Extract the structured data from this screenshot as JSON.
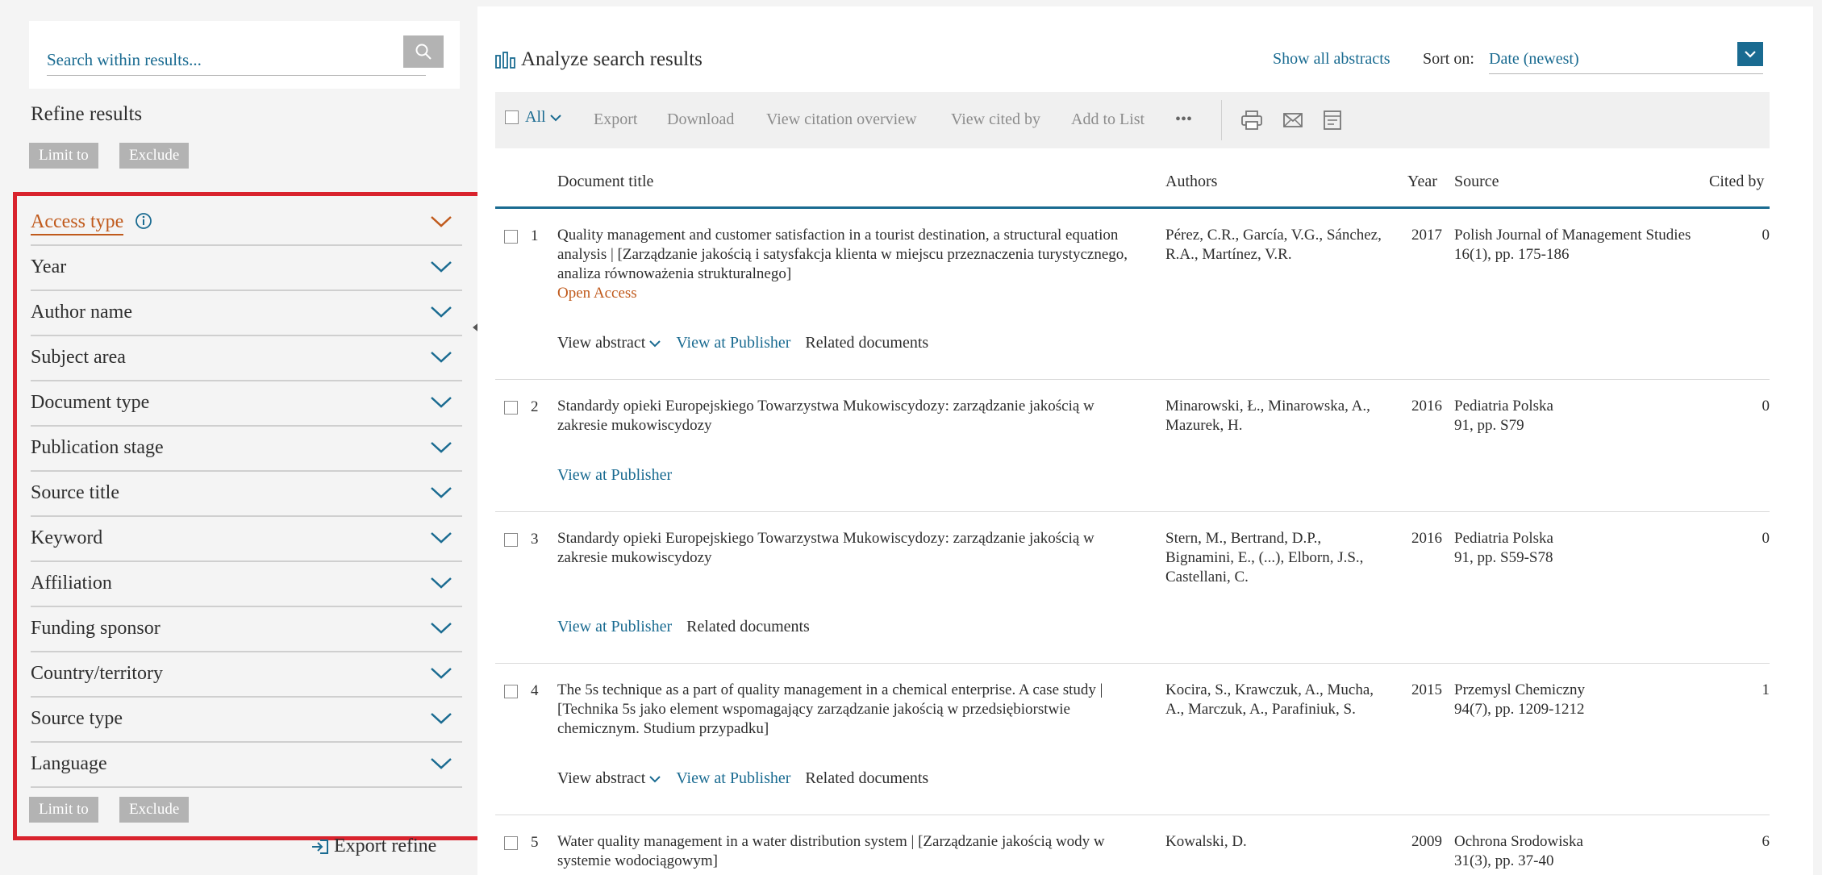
{
  "search": {
    "placeholder": "Search within results..."
  },
  "refine": {
    "title": "Refine results",
    "limit_to": "Limit to",
    "exclude": "Exclude",
    "export_refine": "Export refine",
    "facets": [
      "Access type",
      "Year",
      "Author name",
      "Subject area",
      "Document type",
      "Publication stage",
      "Source title",
      "Keyword",
      "Affiliation",
      "Funding sponsor",
      "Country/territory",
      "Source type",
      "Language"
    ]
  },
  "header": {
    "analyze": "Analyze search results",
    "show_all_abstracts": "Show all abstracts",
    "sort_label": "Sort on:",
    "sort_value": "Date (newest)"
  },
  "toolbar": {
    "all": "All",
    "export": "Export",
    "download": "Download",
    "view_citation_overview": "View citation overview",
    "view_cited_by": "View cited by",
    "add_to_list": "Add to List",
    "more": "•••"
  },
  "columns": {
    "title": "Document title",
    "authors": "Authors",
    "year": "Year",
    "source": "Source",
    "cited_by": "Cited by"
  },
  "results": [
    {
      "num": "1",
      "title": "Quality management and customer satisfaction in a tourist destination, a structural equation analysis | [Zarządzanie jakością i satysfakcja klienta w miejscu przeznaczenia turystycznego, analiza równoważenia strukturalnego]",
      "open_access": "Open Access",
      "authors": "Pérez, C.R., García, V.G., Sánchez, R.A., Martínez, V.R.",
      "year": "2017",
      "source": "Polish Journal of Management Studies",
      "source_detail": "16(1), pp. 175-186",
      "cited": "0",
      "view_abstract": "View abstract",
      "view_at_publisher": "View at Publisher",
      "related": "Related documents"
    },
    {
      "num": "2",
      "title": "Standardy opieki Europejskiego Towarzystwa Mukowiscydozy: zarządzanie jakością w zakresie mukowiscydozy",
      "authors": "Minarowski, Ł., Minarowska, A., Mazurek, H.",
      "year": "2016",
      "source": "Pediatria Polska",
      "source_detail": "91, pp. S79",
      "cited": "0",
      "view_at_publisher": "View at Publisher"
    },
    {
      "num": "3",
      "title": "Standardy opieki Europejskiego Towarzystwa Mukowiscydozy: zarządzanie jakością w zakresie mukowiscydozy",
      "authors": "Stern, M., Bertrand, D.P., Bignamini, E., (...), Elborn, J.S., Castellani, C.",
      "year": "2016",
      "source": "Pediatria Polska",
      "source_detail": "91, pp. S59-S78",
      "cited": "0",
      "view_at_publisher": "View at Publisher",
      "related": "Related documents"
    },
    {
      "num": "4",
      "title": "The 5s technique as a part of quality management in a chemical enterprise. A case study | [Technika 5s jako element wspomagający zarządzanie jakością w przedsiębiorstwie chemicznym. Studium przypadku]",
      "authors": "Kocira, S., Krawczuk, A., Mucha, A., Marczuk, A., Parafiniuk, S.",
      "year": "2015",
      "source": "Przemysl Chemiczny",
      "source_detail": "94(7), pp. 1209-1212",
      "cited": "1",
      "view_abstract": "View abstract",
      "view_at_publisher": "View at Publisher",
      "related": "Related documents"
    },
    {
      "num": "5",
      "title": "Water quality management in a water distribution system | [Zarządzanie jakością wody w systemie wodociągowym]",
      "authors": "Kowalski, D.",
      "year": "2009",
      "source": "Ochrona Srodowiska",
      "source_detail": "31(3), pp. 37-40",
      "cited": "6"
    }
  ],
  "colors": {
    "accent_blue": "#1a6b91",
    "open_access_orange": "#c05a1c",
    "highlight_red": "#d9232d",
    "button_grey": "#b3b3b3"
  }
}
